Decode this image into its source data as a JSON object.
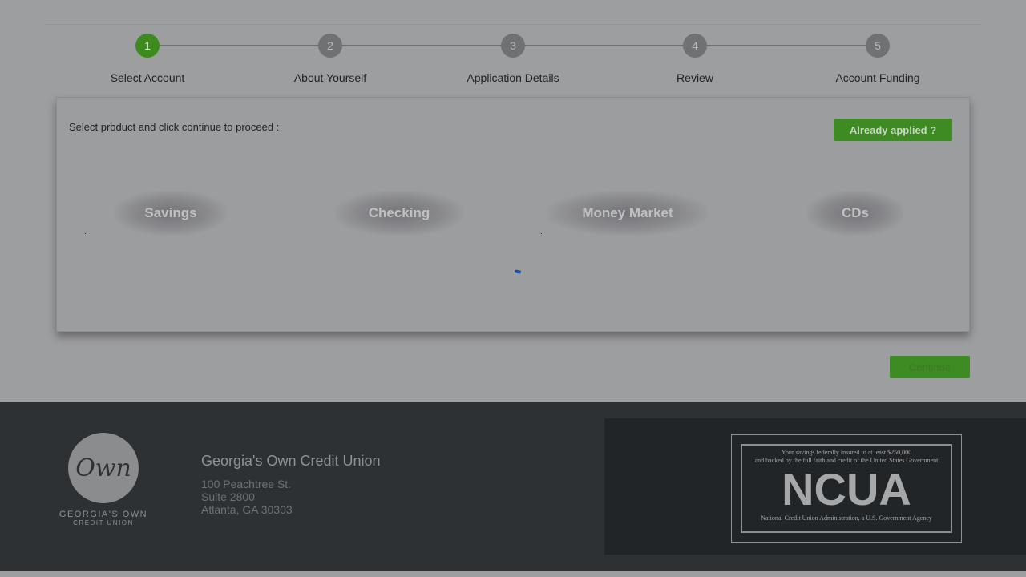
{
  "stepper": {
    "steps": [
      {
        "number": "1",
        "label": "Select Account",
        "active": true
      },
      {
        "number": "2",
        "label": "About Yourself",
        "active": false
      },
      {
        "number": "3",
        "label": "Application Details",
        "active": false
      },
      {
        "number": "4",
        "label": "Review",
        "active": false
      },
      {
        "number": "5",
        "label": "Account Funding",
        "active": false
      }
    ]
  },
  "panel": {
    "instruction": "Select product and click continue to proceed :",
    "already_applied_label": "Already applied ?",
    "products": [
      {
        "label": "Savings"
      },
      {
        "label": "Checking"
      },
      {
        "label": "Money Market"
      },
      {
        "label": "CDs"
      }
    ]
  },
  "continue_label": "Continue",
  "footer": {
    "logo": {
      "script": "Own",
      "name": "GEORGIA'S OWN",
      "subname": "CREDIT UNION"
    },
    "org_name": "Georgia's Own Credit Union",
    "address": [
      "100 Peachtree St.",
      "Suite 2800",
      "Atlanta, GA 30303"
    ],
    "ncua": {
      "line1": "Your savings federally insured to at least $250,000",
      "line2": "and backed by the full faith and credit of the United States Government",
      "title": "NCUA",
      "footer_line": "National Credit Union Administration, a U.S. Government Agency"
    }
  },
  "colors": {
    "accent_green": "#3e8a23",
    "footer_bg": "#2d3133",
    "overlay_bg": "#9d9e9f"
  }
}
